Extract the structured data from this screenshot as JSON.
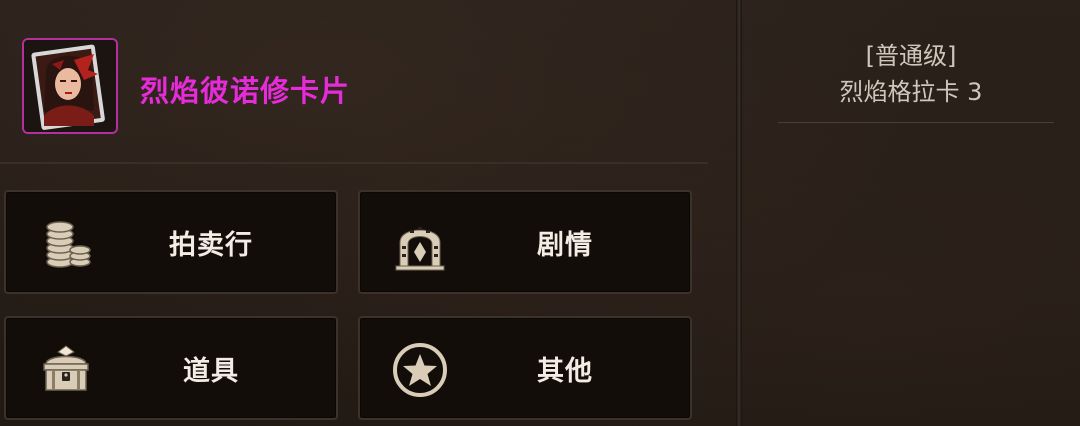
{
  "item": {
    "name": "烈焰彼诺修卡片",
    "rarity_color": "#e62bd8",
    "thumbnail_icon": "character-card-portrait"
  },
  "menu": {
    "buttons": [
      {
        "label": "拍卖行",
        "icon": "gold-coins-icon"
      },
      {
        "label": "剧情",
        "icon": "stone-arch-icon"
      },
      {
        "label": "道具",
        "icon": "treasure-chest-icon"
      },
      {
        "label": "其他",
        "icon": "star-circle-icon"
      }
    ]
  },
  "info": {
    "grade": "[普通级]",
    "set_name": "烈焰格拉卡 3"
  }
}
